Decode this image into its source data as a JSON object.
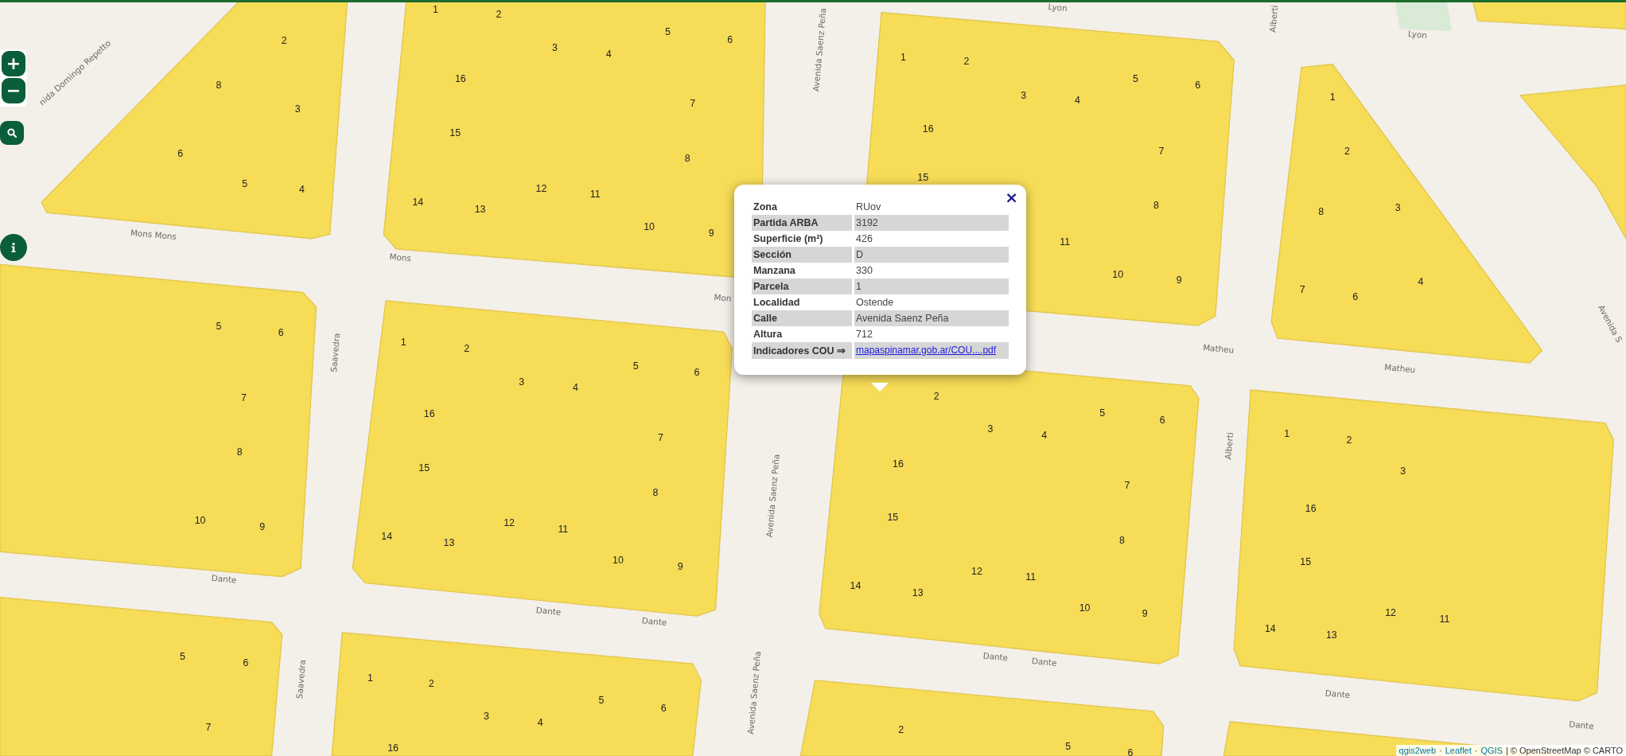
{
  "map": {
    "street_labels": [
      "nida Domingo Repetto",
      "Avenida Saenz Peña",
      "Lyon",
      "Alberti",
      "Lyon",
      "Mons Mons",
      "Mons",
      "Mon",
      "Saavedra",
      "Avenida S",
      "Matheu",
      "Matheu",
      "Avenida Saenz Peña",
      "Alberti",
      "Dante",
      "Dante",
      "Dante",
      "Dante",
      "Dante",
      "Dante",
      "Dante",
      "Saavedra",
      "Avenida Saenz Peña"
    ],
    "blocks": [
      {
        "parcels": [
          "2",
          "8",
          "3",
          "6",
          "5",
          "4"
        ]
      },
      {
        "parcels": [
          "1",
          "2",
          "3",
          "4",
          "5",
          "6",
          "16",
          "7",
          "15",
          "8",
          "12",
          "11",
          "14",
          "13",
          "10",
          "9"
        ]
      },
      {
        "parcels": [
          "1",
          "2",
          "3",
          "4",
          "5",
          "6",
          "16",
          "7",
          "15",
          "8",
          "11",
          "10",
          "9"
        ]
      },
      {
        "parcels": [
          "1",
          "2",
          "8",
          "3",
          "7",
          "6",
          "4"
        ]
      },
      {
        "parcels": [
          "5",
          "6",
          "7",
          "8",
          "10",
          "9"
        ]
      },
      {
        "parcels": [
          "1",
          "2",
          "3",
          "4",
          "5",
          "6",
          "16",
          "7",
          "15",
          "8",
          "12",
          "11",
          "14",
          "13",
          "10",
          "9"
        ]
      },
      {
        "parcels": [
          "2",
          "3",
          "4",
          "5",
          "6",
          "16",
          "7",
          "15",
          "8",
          "12",
          "11",
          "14",
          "13",
          "10",
          "9"
        ]
      },
      {
        "parcels": [
          "1",
          "2",
          "3",
          "16",
          "15",
          "12",
          "11",
          "14",
          "13"
        ]
      },
      {
        "parcels": [
          "5",
          "6",
          "7"
        ]
      },
      {
        "parcels": [
          "1",
          "2",
          "3",
          "4",
          "5",
          "6",
          "16"
        ]
      },
      {
        "parcels": [
          "2",
          "5",
          "6"
        ]
      }
    ]
  },
  "controls": {
    "zoom_in": "+",
    "zoom_out": "−"
  },
  "popup": {
    "close": "×",
    "rows": [
      {
        "kind": "text",
        "label": "Zona",
        "value": "RUov"
      },
      {
        "kind": "text",
        "label": "Partida ARBA",
        "value": "3192"
      },
      {
        "kind": "text",
        "label": "Superficie (m²)",
        "value": "426"
      },
      {
        "kind": "text",
        "label": "Sección",
        "value": "D"
      },
      {
        "kind": "text",
        "label": "Manzana",
        "value": "330"
      },
      {
        "kind": "text",
        "label": "Parcela",
        "value": "1"
      },
      {
        "kind": "text",
        "label": "Localidad",
        "value": "Ostende"
      },
      {
        "kind": "text",
        "label": "Calle",
        "value": "Avenida Saenz Peña"
      },
      {
        "kind": "text",
        "label": "Altura",
        "value": "712"
      },
      {
        "kind": "link",
        "label": "Indicadores COU ⇒",
        "value": "mapaspinamar.gob.ar/COU....pdf"
      }
    ]
  },
  "attribution": [
    {
      "kind": "link",
      "text": "qgis2web"
    },
    {
      "kind": "text",
      "text": "·"
    },
    {
      "kind": "link",
      "text": "Leaflet"
    },
    {
      "kind": "text",
      "text": "·"
    },
    {
      "kind": "link",
      "text": "QGIS"
    },
    {
      "kind": "text",
      "text": "| © OpenStreetMap © CARTO"
    }
  ]
}
